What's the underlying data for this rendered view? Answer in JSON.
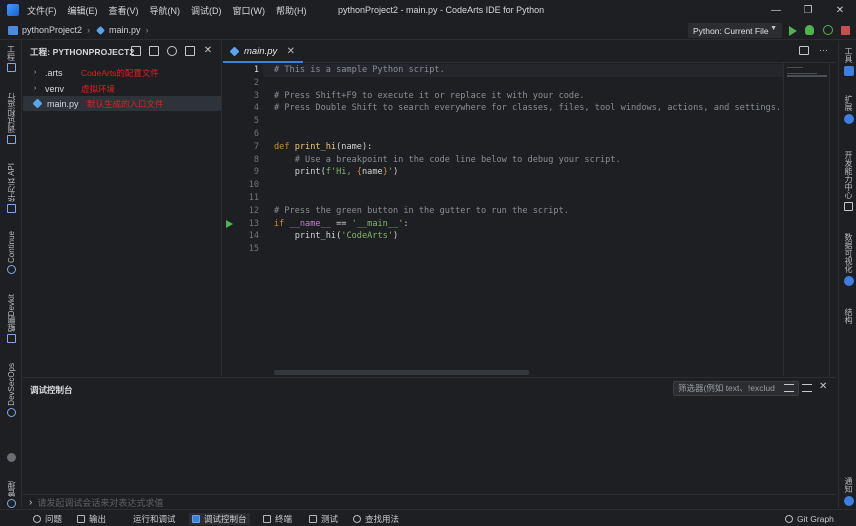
{
  "menu": [
    "文件(F)",
    "编辑(E)",
    "查看(V)",
    "导航(N)",
    "调试(D)",
    "窗口(W)",
    "帮助(H)"
  ],
  "window_title": "pythonProject2 - main.py - CodeArts IDE for Python",
  "window_controls": {
    "minimize": "—",
    "restore": "❐",
    "close": "✕"
  },
  "breadcrumb": {
    "project": "pythonProject2",
    "file": "main.py"
  },
  "run_config": {
    "label": "Python: Current File",
    "caret": "▼"
  },
  "left_strip": [
    {
      "icon": "project-icon",
      "label": "工程"
    },
    {
      "icon": "run-debug-icon",
      "label": "调试和运行"
    },
    {
      "icon": "api-icon",
      "label": "华为云 API"
    },
    {
      "icon": "continue-icon",
      "label": "Continue"
    },
    {
      "icon": "devkit-icon",
      "label": "鲲鹏Devkit"
    },
    {
      "icon": "devsecops-icon",
      "label": "DevSecOps"
    },
    {
      "icon": "account-icon",
      "label": "管理"
    }
  ],
  "right_strip": [
    {
      "icon": "tools-icon",
      "label": "工具"
    },
    {
      "icon": "extensions-icon",
      "label": "扩展"
    },
    {
      "icon": "dev-center-icon",
      "label": "开发能力中心"
    },
    {
      "icon": "data-icon",
      "label": "数据可视化"
    },
    {
      "icon": "structure-icon",
      "label": "结构"
    },
    {
      "icon": "notifications-icon",
      "label": "通知"
    }
  ],
  "project_panel": {
    "title": "工程: PYTHONPROJECT2",
    "tree": [
      {
        "label": ".arts",
        "twisty": "›",
        "annotation": "CodeArts的配置文件"
      },
      {
        "label": "venv",
        "twisty": "›",
        "annotation": "虚拟环境"
      },
      {
        "label": "main.py",
        "twisty": "",
        "annotation": "默认生成的入口文件"
      }
    ],
    "close": "✕"
  },
  "editor": {
    "tab": {
      "label": "main.py",
      "close": "✕"
    },
    "more": "···",
    "current_line": 1,
    "line_numbers": [
      "1",
      "2",
      "3",
      "4",
      "5",
      "6",
      "7",
      "8",
      "9",
      "10",
      "11",
      "12",
      "13",
      "14",
      "15"
    ],
    "lines": [
      [
        {
          "t": "cmt",
          "s": "# This is a sample Python script."
        }
      ],
      [],
      [
        {
          "t": "cmt",
          "s": "# Press Shift+F9 to execute it or replace it with your code."
        }
      ],
      [
        {
          "t": "cmt",
          "s": "# Press Double Shift to search everywhere for classes, files, tool windows, actions, and settings."
        }
      ],
      [],
      [],
      [
        {
          "t": "kw",
          "s": "def "
        },
        {
          "t": "fn",
          "s": "print_hi"
        },
        {
          "t": "plain",
          "s": "(name):"
        }
      ],
      [
        {
          "t": "cmt",
          "s": "    # Use a breakpoint in the code line below to debug your script."
        }
      ],
      [
        {
          "t": "plain",
          "s": "    print("
        },
        {
          "t": "str",
          "s": "f'Hi, "
        },
        {
          "t": "fmt",
          "s": "{"
        },
        {
          "t": "plain",
          "s": "name"
        },
        {
          "t": "fmt",
          "s": "}"
        },
        {
          "t": "str",
          "s": "'"
        },
        {
          "t": "plain",
          "s": ")"
        }
      ],
      [],
      [],
      [
        {
          "t": "cmt",
          "s": "# Press the green button in the gutter to run the script."
        }
      ],
      [
        {
          "t": "kw",
          "s": "if "
        },
        {
          "t": "dunder",
          "s": "__name__"
        },
        {
          "t": "plain",
          "s": " == "
        },
        {
          "t": "str",
          "s": "'__main__'"
        },
        {
          "t": "plain",
          "s": ":"
        }
      ],
      [
        {
          "t": "plain",
          "s": "    print_hi("
        },
        {
          "t": "str",
          "s": "'CodeArts'"
        },
        {
          "t": "plain",
          "s": ")"
        }
      ],
      []
    ],
    "run_gutter_line": 13
  },
  "console": {
    "title": "调试控制台",
    "filter_placeholder": "筛选器(例如 text、!exclud",
    "close": "✕",
    "input_prompt": "›",
    "input_placeholder": "请发起调试会话来对表达式求值"
  },
  "statusbar": [
    {
      "icon": "problems-icon",
      "label": "问题",
      "active": false
    },
    {
      "icon": "output-icon",
      "label": "输出",
      "active": false
    },
    {
      "icon": "run-debug-icon",
      "label": "运行和调试",
      "active": false
    },
    {
      "icon": "debug-console-icon",
      "label": "调试控制台",
      "active": true
    },
    {
      "icon": "terminal-icon",
      "label": "终端",
      "active": false
    },
    {
      "icon": "test-icon",
      "label": "测试",
      "active": false
    },
    {
      "icon": "find-usages-icon",
      "label": "查找用法",
      "active": false
    },
    {
      "icon": "git-graph-icon",
      "label": "Git Graph",
      "active": false
    }
  ],
  "colors": {
    "background": "#1e1f22",
    "accent": "#3d7ee0",
    "annotation": "#e02020",
    "run_green": "#4fb34f",
    "stop_red": "#c94f4f"
  }
}
